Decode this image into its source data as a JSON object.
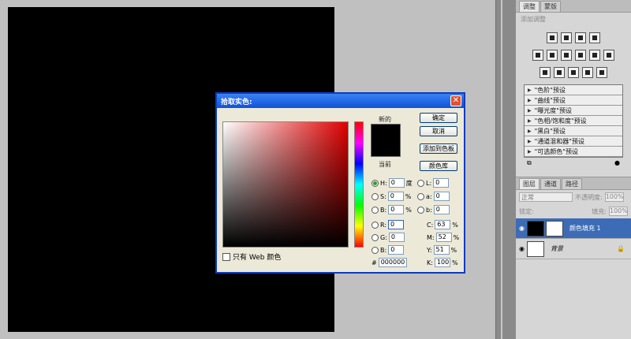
{
  "layers_panel": {
    "tabs": [
      "图层",
      "通道",
      "路径"
    ],
    "blend_mode": "正常",
    "opacity_label": "不透明度:",
    "opacity": "100%",
    "lock_label": "锁定:",
    "fill_label": "填充:",
    "fill": "100%",
    "layers": [
      {
        "name": "颜色填充 1",
        "selected": true
      },
      {
        "name": "背景",
        "selected": false
      }
    ]
  },
  "adjustments_panel": {
    "tabs": [
      "调整",
      "蒙版"
    ],
    "subtitle": "添加调整",
    "presets": [
      "\"色阶\"预设",
      "\"曲线\"预设",
      "\"曝光度\"预设",
      "\"色相/饱和度\"预设",
      "\"黑白\"预设",
      "\"通道混和器\"预设",
      "\"可选颜色\"预设"
    ]
  },
  "dialog": {
    "title": "拾取实色:",
    "close": "✕",
    "new_label": "新的",
    "current_label": "当前",
    "buttons": {
      "ok": "确定",
      "cancel": "取消",
      "add_swatch": "添加到色板",
      "color_libraries": "颜色库"
    },
    "web_only_label": "只有 Web 颜色",
    "fields": {
      "H": {
        "label": "H:",
        "value": "0",
        "unit": "度"
      },
      "S": {
        "label": "S:",
        "value": "0",
        "unit": "%"
      },
      "B": {
        "label": "B:",
        "value": "0",
        "unit": "%"
      },
      "R": {
        "label": "R:",
        "value": "0"
      },
      "G": {
        "label": "G:",
        "value": "0"
      },
      "Bl": {
        "label": "B:",
        "value": "0"
      },
      "L": {
        "label": "L:",
        "value": "0"
      },
      "a": {
        "label": "a:",
        "value": "0"
      },
      "b": {
        "label": "b:",
        "value": "0"
      },
      "C": {
        "label": "C:",
        "value": "63",
        "unit": "%"
      },
      "M": {
        "label": "M:",
        "value": "52",
        "unit": "%"
      },
      "Y": {
        "label": "Y:",
        "value": "51",
        "unit": "%"
      },
      "K": {
        "label": "K:",
        "value": "100",
        "unit": "%"
      },
      "hex": {
        "label": "#",
        "value": "000000"
      }
    },
    "colors": {
      "current": "#000000",
      "new": "#000000"
    }
  }
}
